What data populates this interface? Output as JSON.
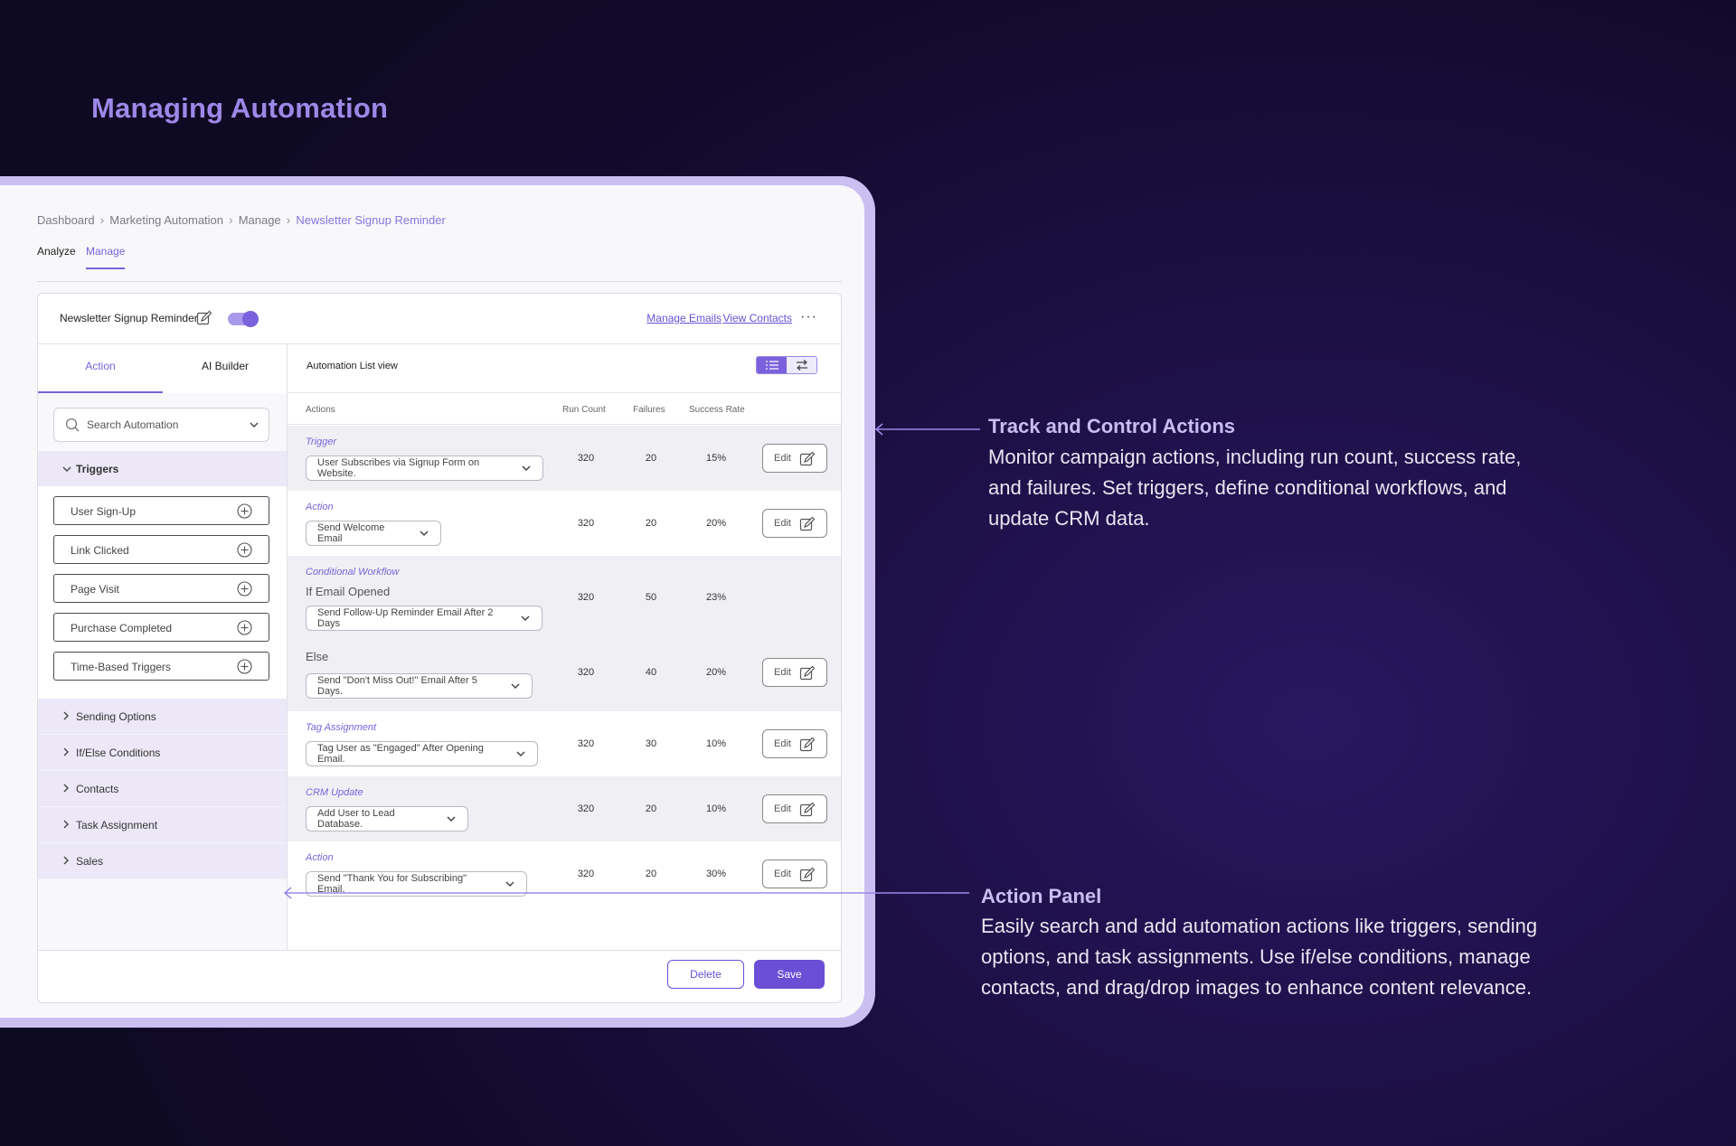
{
  "page_title": "Managing Automation",
  "breadcrumb": [
    "Dashboard",
    "Marketing Automation",
    "Manage",
    "Newsletter Signup Reminder"
  ],
  "tabs": [
    "Analyze",
    "Manage"
  ],
  "header": {
    "title": "Newsletter Signup Reminder",
    "toggle_on": true,
    "manage_emails": "Manage Emails",
    "view_contacts": "View Contacts",
    "more": "···"
  },
  "left_panel": {
    "tabs": [
      "Action",
      "AI Builder"
    ],
    "search_placeholder": "Search Automation",
    "triggers_label": "Triggers",
    "trigger_items": [
      "User Sign-Up",
      "Link Clicked",
      "Page Visit",
      "Purchase Completed",
      "Time-Based Triggers"
    ],
    "sections": [
      "Sending Options",
      "If/Else Conditions",
      "Contacts",
      "Task Assignment",
      "Sales"
    ]
  },
  "main": {
    "title": "Automation List view",
    "columns": [
      "Actions",
      "Run Count",
      "Failures",
      "Success Rate"
    ],
    "rows": [
      {
        "type": "Trigger",
        "value": "User Subscribes via Signup Form on Website.",
        "run": "320",
        "fail": "20",
        "rate": "15%",
        "edit": "Edit"
      },
      {
        "type": "Action",
        "value": "Send Welcome Email",
        "run": "320",
        "fail": "20",
        "rate": "20%",
        "edit": "Edit"
      },
      {
        "type": "Conditional Workflow",
        "sub": "If Email Opened",
        "value": "Send Follow-Up Reminder Email After 2 Days",
        "run": "320",
        "fail": "50",
        "rate": "23%"
      },
      {
        "sub": "Else",
        "value": "Send \"Don't Miss Out!\" Email After 5 Days.",
        "run": "320",
        "fail": "40",
        "rate": "20%",
        "edit": "Edit"
      },
      {
        "type": "Tag Assignment",
        "value": "Tag User as \"Engaged\" After Opening Email.",
        "run": "320",
        "fail": "30",
        "rate": "10%",
        "edit": "Edit"
      },
      {
        "type": "CRM Update",
        "value": "Add User to Lead Database.",
        "run": "320",
        "fail": "20",
        "rate": "10%",
        "edit": "Edit"
      },
      {
        "type": "Action",
        "value": "Send \"Thank You for Subscribing\" Email.",
        "run": "320",
        "fail": "20",
        "rate": "30%",
        "edit": "Edit"
      }
    ]
  },
  "footer": {
    "delete": "Delete",
    "save": "Save"
  },
  "annotations": {
    "track_title": "Track and Control Actions",
    "track_desc": "Monitor campaign actions, including run count, success rate, and failures. Set triggers, define conditional workflows, and update CRM data.",
    "panel_title": "Action Panel",
    "panel_desc": "Easily search and add automation actions like triggers, sending options, and task assignments. Use if/else conditions, manage contacts, and drag/drop images to enhance content relevance."
  },
  "colors": {
    "accent": "#7b62dc",
    "title": "#9d88e8",
    "frame": "#cbbff2",
    "background": "#1b0f42"
  }
}
